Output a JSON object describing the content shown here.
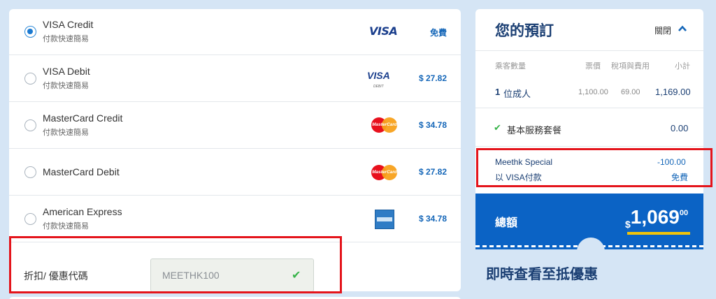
{
  "payment_methods": [
    {
      "name": "VISA Credit",
      "sub": "付款快速簡易",
      "logo": "VISA",
      "fee": "免費",
      "selected": true
    },
    {
      "name": "VISA Debit",
      "sub": "付款快速簡易",
      "logo": "VISA",
      "logo_sub": "DEBIT",
      "fee": "$ 27.82",
      "selected": false
    },
    {
      "name": "MasterCard Credit",
      "sub": "付款快速簡易",
      "logo": "MasterCard",
      "fee": "$ 34.78",
      "selected": false
    },
    {
      "name": "MasterCard Debit",
      "logo": "MasterCard",
      "fee": "$ 27.82",
      "selected": false
    },
    {
      "name": "American Express",
      "sub": "付款快速簡易",
      "fee": "$ 34.78",
      "selected": false
    }
  ],
  "promo": {
    "label": "折扣/ 優惠代碼",
    "value": "MEETHK100"
  },
  "booking": {
    "title": "您的預訂",
    "close_label": "關閉",
    "headers": {
      "passengers": "乘客數量",
      "fare": "票價",
      "tax": "稅項與費用",
      "subtotal": "小計"
    },
    "adult_row": {
      "count": "1",
      "label": "位成人",
      "fare": "1,100.00",
      "tax": "69.00",
      "subtotal": "1,169.00"
    },
    "service_row": {
      "label": "基本服務套餐",
      "amount": "0.00"
    },
    "special_row": {
      "label": "Meethk Special",
      "amount": "-100.00"
    },
    "visa_row": {
      "label": "以 VISA付款",
      "amount": "免費"
    },
    "total": {
      "label": "總額",
      "currency": "$",
      "integer": "1,069",
      "decimal": "00"
    }
  },
  "promo_headline": "即時查看至抵優惠",
  "colors": {
    "accent": "#0b63c5",
    "navy": "#1b3f73",
    "highlight": "#e4141b",
    "underline": "#f2c40a",
    "check": "#38b44a"
  }
}
